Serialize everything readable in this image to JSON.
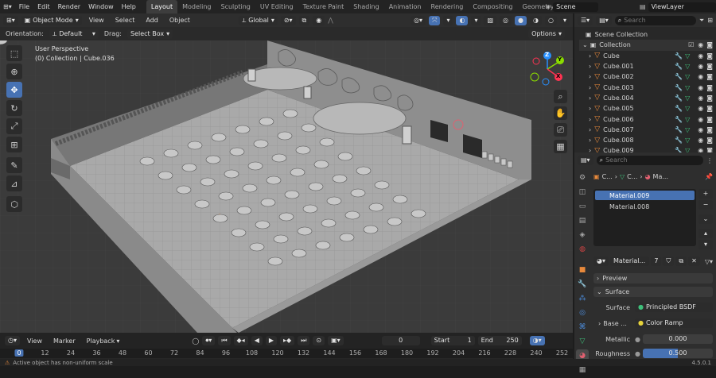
{
  "topbar": {
    "menus": [
      "File",
      "Edit",
      "Render",
      "Window",
      "Help"
    ],
    "workspaces": [
      "Layout",
      "Modeling",
      "Sculpting",
      "UV Editing",
      "Texture Paint",
      "Shading",
      "Animation",
      "Rendering",
      "Compositing",
      "Geometry Node"
    ],
    "active_workspace": "Layout",
    "scene": "Scene",
    "view_layer": "ViewLayer"
  },
  "viewport_header": {
    "mode": "Object Mode",
    "menus": [
      "View",
      "Select",
      "Add",
      "Object"
    ],
    "transform_orientation": "Global"
  },
  "tool_settings": {
    "orientation_label": "Orientation:",
    "orientation_value": "Default",
    "drag_label": "Drag:",
    "drag_value": "Select Box",
    "options_label": "Options"
  },
  "viewport": {
    "perspective": "User Perspective",
    "collection_info": "(0) Collection | Cube.036",
    "axis_labels": {
      "z": "Z",
      "y": "Y",
      "x": "X"
    }
  },
  "outliner": {
    "search_placeholder": "Search",
    "scene_collection": "Scene Collection",
    "collection": "Collection",
    "objects": [
      "Cube",
      "Cube.001",
      "Cube.002",
      "Cube.003",
      "Cube.004",
      "Cube.005",
      "Cube.006",
      "Cube.007",
      "Cube.008",
      "Cube.009"
    ]
  },
  "properties": {
    "search_placeholder": "Search",
    "breadcrumb": [
      "C...",
      "C...",
      "Ma..."
    ],
    "materials": [
      "Material.009",
      "Material.008"
    ],
    "selected_material": "Material.009",
    "material_field": "Material...",
    "user_count": "7",
    "preview_label": "Preview",
    "surface_label": "Surface",
    "surface_prop": "Surface",
    "surface_value": "Principled BSDF",
    "base_color_label": "Base ...",
    "base_color_value": "Color Ramp",
    "metallic_label": "Metallic",
    "metallic_value": "0.000",
    "roughness_label": "Roughness",
    "roughness_value": "0.500"
  },
  "timeline": {
    "menus": [
      "View",
      "Marker",
      "Playback"
    ],
    "current_frame": "0",
    "start_label": "Start",
    "start_value": "1",
    "end_label": "End",
    "end_value": "250",
    "ruler": [
      "0",
      "12",
      "24",
      "36",
      "48",
      "60",
      "72",
      "84",
      "96",
      "108",
      "120",
      "132",
      "144",
      "156",
      "168",
      "180",
      "192",
      "204",
      "216",
      "228",
      "240",
      "252"
    ]
  },
  "status": {
    "message": "Active object has non-uniform scale",
    "version": "4.5.0.1"
  },
  "colors": {
    "accent": "#4772b3",
    "background": "#1d1d1d",
    "header": "#2e2e2e",
    "panel": "#282828",
    "viewport": "#3a3a3a",
    "axis_x": "#ff3352",
    "axis_y": "#8bdc00",
    "axis_z": "#2890ff"
  }
}
